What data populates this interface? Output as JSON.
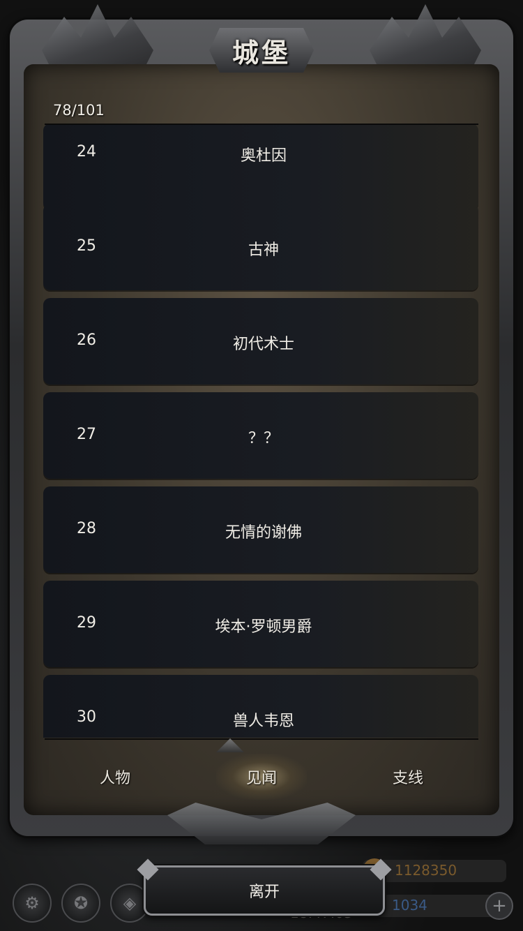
{
  "title": "城堡",
  "counter": "78/101",
  "entries": [
    {
      "num": "24",
      "name": "奥杜因"
    },
    {
      "num": "25",
      "name": "古神"
    },
    {
      "num": "26",
      "name": "初代术士"
    },
    {
      "num": "27",
      "name": "？？"
    },
    {
      "num": "28",
      "name": "无情的谢佛"
    },
    {
      "num": "29",
      "name": "埃本·罗顿男爵"
    },
    {
      "num": "30",
      "name": "兽人韦恩"
    }
  ],
  "tabs": [
    {
      "label": "人物",
      "active": false
    },
    {
      "label": "见闻",
      "active": true
    },
    {
      "label": "支线",
      "active": false
    }
  ],
  "leave_label": "离开",
  "hud": {
    "gold": "1128350",
    "gems": "1034",
    "time": "18:47:03",
    "gold_color": "#7a5a2c",
    "gem_color": "#3a5a86"
  }
}
